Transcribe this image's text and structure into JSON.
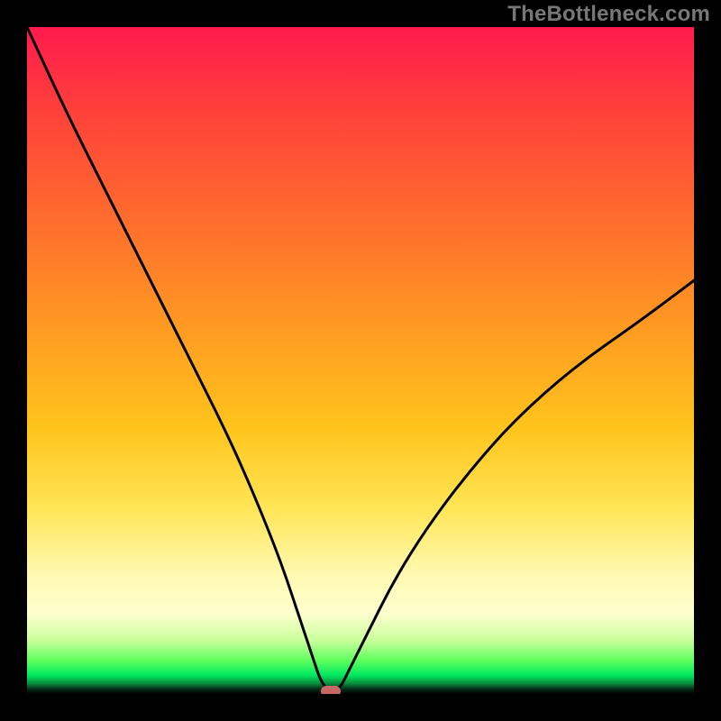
{
  "watermark": "TheBottleneck.com",
  "chart_data": {
    "type": "line",
    "title": "",
    "xlabel": "",
    "ylabel": "",
    "xlim": [
      0,
      100
    ],
    "ylim": [
      0,
      100
    ],
    "grid": false,
    "legend": false,
    "background_gradient": {
      "orientation": "vertical",
      "stops": [
        {
          "pos": 0.0,
          "color": "#ff1a4d"
        },
        {
          "pos": 0.12,
          "color": "#ff3f3b"
        },
        {
          "pos": 0.28,
          "color": "#ff6a2e"
        },
        {
          "pos": 0.45,
          "color": "#ff9a22"
        },
        {
          "pos": 0.6,
          "color": "#ffc41c"
        },
        {
          "pos": 0.72,
          "color": "#ffe554"
        },
        {
          "pos": 0.82,
          "color": "#fff9b0"
        },
        {
          "pos": 0.88,
          "color": "#fdffce"
        },
        {
          "pos": 0.92,
          "color": "#c9ff9a"
        },
        {
          "pos": 0.95,
          "color": "#5eff5e"
        },
        {
          "pos": 0.972,
          "color": "#00e860"
        },
        {
          "pos": 0.984,
          "color": "#0b8f3e"
        },
        {
          "pos": 0.992,
          "color": "#04311a"
        },
        {
          "pos": 1.0,
          "color": "#000000"
        }
      ]
    },
    "series": [
      {
        "name": "bottleneck-curve",
        "color": "#000000",
        "stroke_width": 3,
        "x": [
          0,
          6,
          12,
          18,
          24,
          30,
          34,
          38,
          41,
          43,
          44,
          45.5,
          47,
          48,
          51,
          55,
          60,
          66,
          73,
          82,
          92,
          100
        ],
        "y": [
          100,
          87,
          75,
          63,
          51,
          39,
          30,
          20,
          11,
          5,
          2,
          0,
          1,
          3,
          9,
          17,
          25,
          33,
          41,
          49,
          56,
          62
        ]
      }
    ],
    "marker": {
      "name": "optimal-point",
      "x": 45.5,
      "y": 0,
      "width_x_units": 3.0,
      "color": "#d6706f",
      "shape": "rounded-bar"
    }
  }
}
